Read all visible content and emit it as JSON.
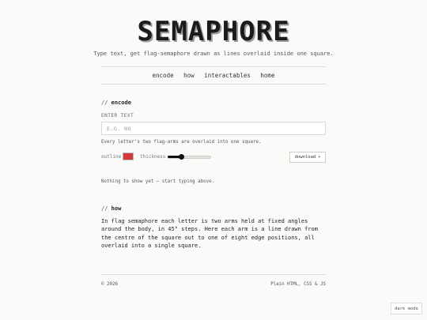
{
  "header": {
    "logo": "SEMAPHORE",
    "tagline": "Type text, get flag-semaphore drawn as lines overlaid inside one square."
  },
  "nav": {
    "items": [
      "encode",
      "how",
      "interactables",
      "home"
    ]
  },
  "encode": {
    "prefix": "//",
    "heading": "encode",
    "input_label": "ENTER TEXT",
    "input_value": "",
    "input_placeholder": "E.G. NO",
    "hint": "Every letter's two flag-arms are overlaid into one square.",
    "outline_label": "outline",
    "outline_color": "#d23a3a",
    "thickness_label": "thickness",
    "thickness_level": 0.3,
    "download_label": "download",
    "status": "Nothing to show yet — start typing above."
  },
  "how": {
    "prefix": "//",
    "heading": "how",
    "text": "In flag semaphore each letter is two arms held at fixed angles around the body, in 45° steps. Here each arm is a line drawn from the centre of the square out to one of eight edge positions, all overlaid into a single square."
  },
  "footer": {
    "left": "© 2026",
    "right": "Plain HTML, CSS & JS"
  },
  "dark_mode_label": "dark mode"
}
